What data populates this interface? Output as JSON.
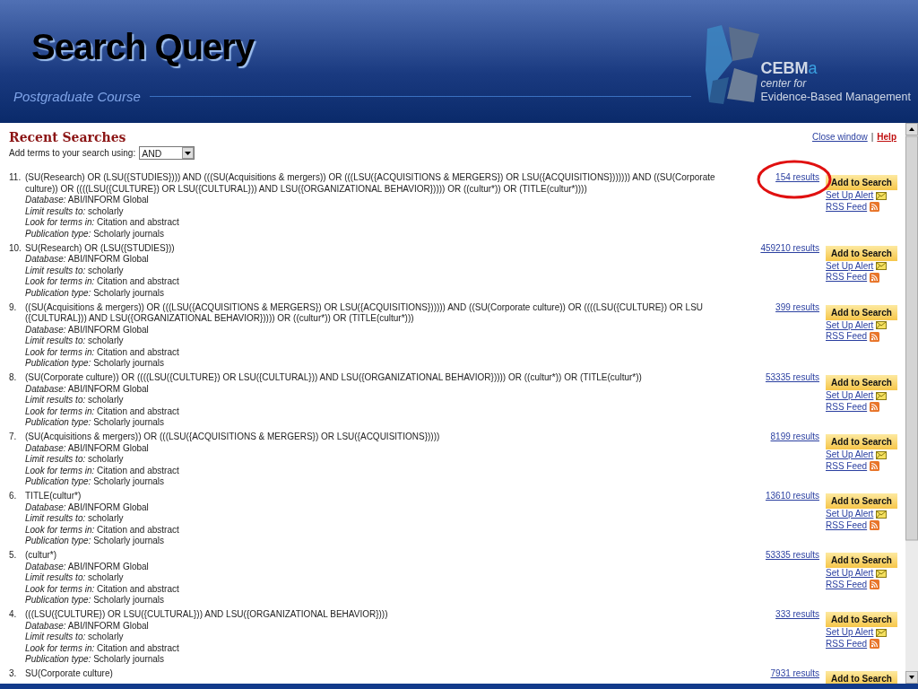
{
  "slide": {
    "title": "Search Query",
    "subtitle": "Postgraduate Course",
    "logo": {
      "name": "CEBM",
      "suffix": "a",
      "line1": "center for",
      "line2": "Evidence-Based Management"
    }
  },
  "page": {
    "heading": "Recent Searches",
    "links": [
      {
        "label": "Close window",
        "kind": "plain"
      },
      {
        "label": "|",
        "kind": "separator"
      },
      {
        "label": "Help",
        "kind": "help"
      }
    ],
    "combine": {
      "label": "Add terms to your search using:",
      "value": "AND"
    },
    "entries": [
      {
        "number": "11.",
        "query": "(SU(Research) OR (LSU({STUDIES}))) AND (((SU(Acquisitions & mergers)) OR (((LSU({ACQUISITIONS & MERGERS}) OR LSU({ACQUISITIONS})))))) AND ((SU(Corporate culture)) OR ((((LSU({CULTURE}) OR LSU({CULTURAL})) AND LSU({ORGANIZATIONAL BEHAVIOR})))) OR ((cultur*)) OR (TITLE(cultur*))))",
        "results": "154 results",
        "highlighted": true,
        "button": "Add to Search",
        "alert": "Set Up Alert",
        "rss": "RSS Feed",
        "details": [
          {
            "label": "Database:",
            "value": "ABI/INFORM Global"
          },
          {
            "label": "Limit results to:",
            "value": "scholarly"
          },
          {
            "label": "Look for terms in:",
            "value": "Citation and abstract"
          },
          {
            "label": "Publication type:",
            "value": "Scholarly journals"
          }
        ]
      },
      {
        "number": "10.",
        "query": "SU(Research) OR (LSU({STUDIES}))",
        "results": "459210 results",
        "highlighted": false,
        "button": "Add to Search",
        "alert": "Set Up Alert",
        "rss": "RSS Feed",
        "details": [
          {
            "label": "Database:",
            "value": "ABI/INFORM Global"
          },
          {
            "label": "Limit results to:",
            "value": "scholarly"
          },
          {
            "label": "Look for terms in:",
            "value": "Citation and abstract"
          },
          {
            "label": "Publication type:",
            "value": "Scholarly journals"
          }
        ]
      },
      {
        "number": "9.",
        "query": "((SU(Acquisitions & mergers)) OR (((LSU({ACQUISITIONS & MERGERS}) OR LSU({ACQUISITIONS}))))) AND ((SU(Corporate culture)) OR ((((LSU({CULTURE}) OR LSU ({CULTURAL})) AND LSU({ORGANIZATIONAL BEHAVIOR})))) OR ((cultur*)) OR (TITLE(cultur*)))",
        "results": "399 results",
        "highlighted": false,
        "button": "Add to Search",
        "alert": "Set Up Alert",
        "rss": "RSS Feed",
        "details": [
          {
            "label": "Database:",
            "value": "ABI/INFORM Global"
          },
          {
            "label": "Limit results to:",
            "value": "scholarly"
          },
          {
            "label": "Look for terms in:",
            "value": "Citation and abstract"
          },
          {
            "label": "Publication type:",
            "value": "Scholarly journals"
          }
        ]
      },
      {
        "number": "8.",
        "query": "(SU(Corporate culture)) OR ((((LSU({CULTURE}) OR LSU({CULTURAL})) AND LSU({ORGANIZATIONAL BEHAVIOR})))) OR ((cultur*)) OR (TITLE(cultur*))",
        "results": "53335 results",
        "highlighted": false,
        "button": "Add to Search",
        "alert": "Set Up Alert",
        "rss": "RSS Feed",
        "details": [
          {
            "label": "Database:",
            "value": "ABI/INFORM Global"
          },
          {
            "label": "Limit results to:",
            "value": "scholarly"
          },
          {
            "label": "Look for terms in:",
            "value": "Citation and abstract"
          },
          {
            "label": "Publication type:",
            "value": "Scholarly journals"
          }
        ]
      },
      {
        "number": "7.",
        "query": "(SU(Acquisitions & mergers)) OR (((LSU({ACQUISITIONS & MERGERS}) OR LSU({ACQUISITIONS}))))",
        "results": "8199 results",
        "highlighted": false,
        "button": "Add to Search",
        "alert": "Set Up Alert",
        "rss": "RSS Feed",
        "details": [
          {
            "label": "Database:",
            "value": "ABI/INFORM Global"
          },
          {
            "label": "Limit results to:",
            "value": "scholarly"
          },
          {
            "label": "Look for terms in:",
            "value": "Citation and abstract"
          },
          {
            "label": "Publication type:",
            "value": "Scholarly journals"
          }
        ]
      },
      {
        "number": "6.",
        "query": "TITLE(cultur*)",
        "results": "13610 results",
        "highlighted": false,
        "button": "Add to Search",
        "alert": "Set Up Alert",
        "rss": "RSS Feed",
        "details": [
          {
            "label": "Database:",
            "value": "ABI/INFORM Global"
          },
          {
            "label": "Limit results to:",
            "value": "scholarly"
          },
          {
            "label": "Look for terms in:",
            "value": "Citation and abstract"
          },
          {
            "label": "Publication type:",
            "value": "Scholarly journals"
          }
        ]
      },
      {
        "number": "5.",
        "query": "(cultur*)",
        "results": "53335 results",
        "highlighted": false,
        "button": "Add to Search",
        "alert": "Set Up Alert",
        "rss": "RSS Feed",
        "details": [
          {
            "label": "Database:",
            "value": "ABI/INFORM Global"
          },
          {
            "label": "Limit results to:",
            "value": "scholarly"
          },
          {
            "label": "Look for terms in:",
            "value": "Citation and abstract"
          },
          {
            "label": "Publication type:",
            "value": "Scholarly journals"
          }
        ]
      },
      {
        "number": "4.",
        "query": "(((LSU({CULTURE}) OR LSU({CULTURAL})) AND LSU({ORGANIZATIONAL BEHAVIOR})))",
        "results": "333 results",
        "highlighted": false,
        "button": "Add to Search",
        "alert": "Set Up Alert",
        "rss": "RSS Feed",
        "details": [
          {
            "label": "Database:",
            "value": "ABI/INFORM Global"
          },
          {
            "label": "Limit results to:",
            "value": "scholarly"
          },
          {
            "label": "Look for terms in:",
            "value": "Citation and abstract"
          },
          {
            "label": "Publication type:",
            "value": "Scholarly journals"
          }
        ]
      },
      {
        "number": "3.",
        "query": "SU(Corporate culture)",
        "results": "7931 results",
        "highlighted": false,
        "button": "Add to Search"
      }
    ]
  }
}
